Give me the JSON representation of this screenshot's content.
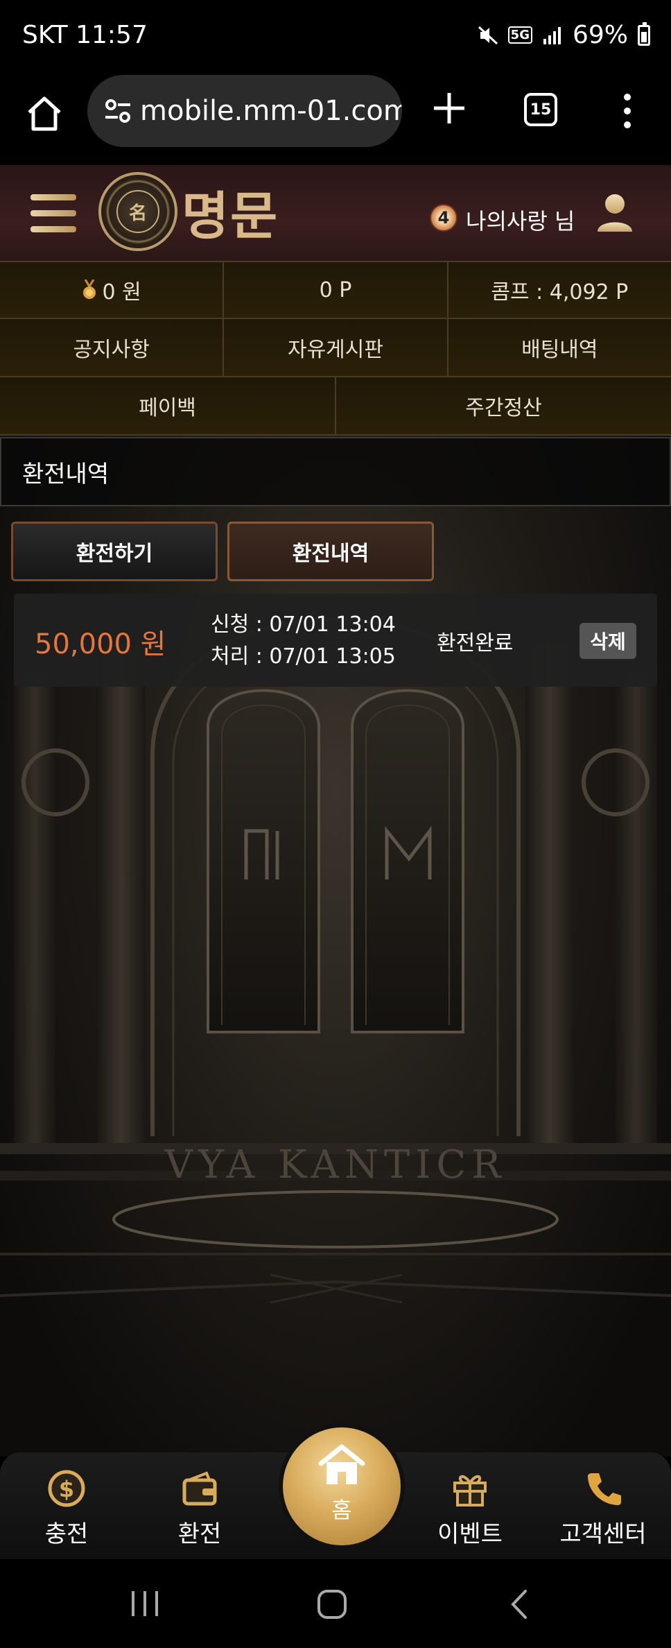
{
  "status_bar": {
    "carrier_time": "SKT 11:57",
    "network": "5G",
    "battery": "69%"
  },
  "browser": {
    "url": "mobile.mm-01.com",
    "tab_count": "15"
  },
  "header": {
    "logo_text": "명문",
    "user_level": "4",
    "user_name": "나의사랑 님"
  },
  "info": {
    "balance": "0 원",
    "points": "0 P",
    "comp": "콤프 : 4,092 P"
  },
  "menu": [
    {
      "label": "공지사항"
    },
    {
      "label": "자유게시판"
    },
    {
      "label": "배팅내역"
    },
    {
      "label": "페이백"
    },
    {
      "label": "주간정산"
    }
  ],
  "page_title": "환전내역",
  "tabs": {
    "withdraw": "환전하기",
    "history": "환전내역"
  },
  "records": [
    {
      "amount": "50,000 원",
      "requested": "신청 : 07/01 13:04",
      "processed": "처리 : 07/01 13:05",
      "status": "환전완료",
      "delete_label": "삭제"
    }
  ],
  "background_text": "VYA KANTICR",
  "bottom_nav": {
    "charge": "충전",
    "exchange": "환전",
    "home": "홈",
    "event": "이벤트",
    "support": "고객센터"
  },
  "colors": {
    "accent_gold": "#d9ac5c",
    "amount_orange": "#e8763a",
    "header_maroon": "#3a1e1e"
  }
}
